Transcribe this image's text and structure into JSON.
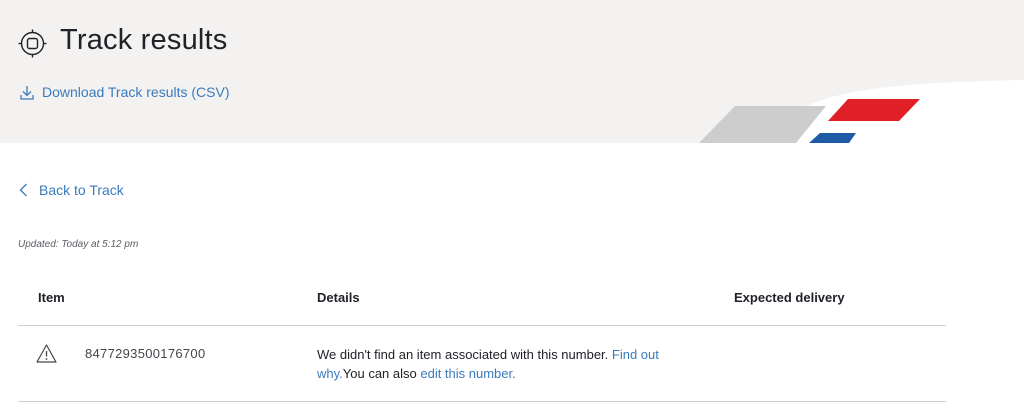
{
  "header": {
    "title": "Track results",
    "title_icon": "tracking-target-icon",
    "download_label": "Download Track results (CSV)",
    "download_icon": "download-icon",
    "brand_colors": {
      "red": "#e01f26",
      "blue": "#1f5aa6",
      "grey": "#c9c9c9"
    }
  },
  "nav": {
    "back_label": "Back to Track",
    "back_icon": "chevron-left-icon"
  },
  "status": {
    "updated": "Updated: Today at 5:12 pm"
  },
  "table": {
    "columns": [
      "Item",
      "Details",
      "Expected delivery"
    ],
    "rows": [
      {
        "status_icon": "warning-icon",
        "item": "8477293500176700",
        "details_text": "We didn't find an item associated with this number. ",
        "find_out_link": "Find out why.",
        "middle_text": "You can also ",
        "edit_link": "edit this number.",
        "expected_delivery": ""
      }
    ]
  },
  "colors": {
    "link": "#3a7bbd",
    "header_bg": "#f3f2f1",
    "divider": "#cfcfd2"
  }
}
